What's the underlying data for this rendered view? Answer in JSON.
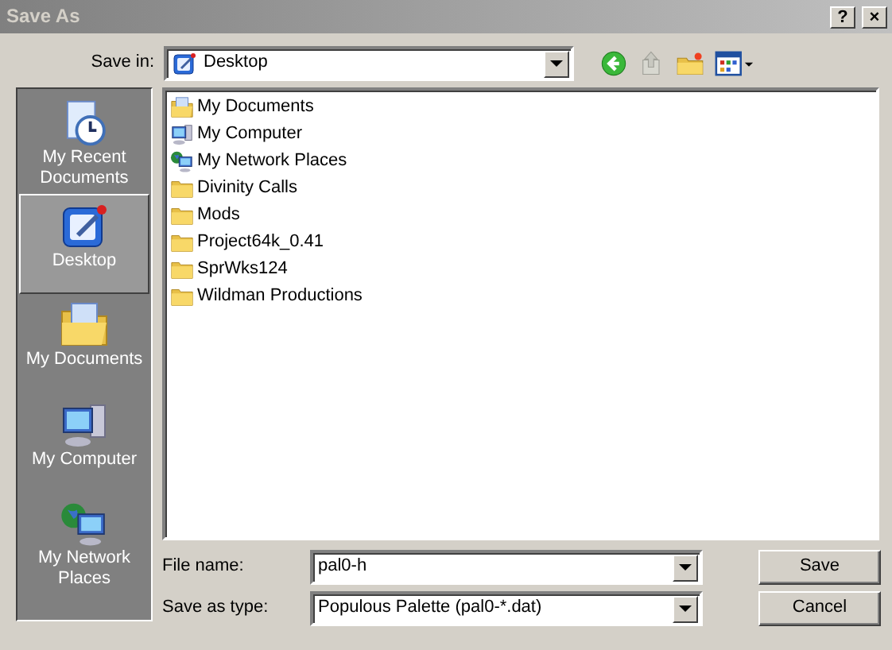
{
  "window": {
    "title": "Save As",
    "buttons": [
      "?",
      "×"
    ]
  },
  "save_in": {
    "label": "Save in:",
    "value": "Desktop",
    "kind": "desktop"
  },
  "toolbar": [
    {
      "kind": "back"
    },
    {
      "kind": "up"
    },
    {
      "kind": "new-folder"
    },
    {
      "kind": "views"
    }
  ],
  "places": [
    {
      "label": "My Recent Documents",
      "kind": "recent",
      "selected": false
    },
    {
      "label": "Desktop",
      "kind": "desktop",
      "selected": true
    },
    {
      "label": "My Documents",
      "kind": "documents",
      "selected": false
    },
    {
      "label": "My Computer",
      "kind": "computer",
      "selected": false
    },
    {
      "label": "My Network Places",
      "kind": "network",
      "selected": false
    }
  ],
  "files": [
    {
      "name": "My Documents",
      "kind": "documents"
    },
    {
      "name": "My Computer",
      "kind": "computer"
    },
    {
      "name": "My Network Places",
      "kind": "network"
    },
    {
      "name": "Divinity Calls",
      "kind": "folder"
    },
    {
      "name": "Mods",
      "kind": "folder"
    },
    {
      "name": "Project64k_0.41",
      "kind": "folder"
    },
    {
      "name": "SprWks124",
      "kind": "folder"
    },
    {
      "name": "Wildman Productions",
      "kind": "folder"
    }
  ],
  "file_name": {
    "label": "File name:",
    "value": "pal0-h"
  },
  "save_as_type": {
    "label": "Save as type:",
    "value": "Populous Palette (pal0-*.dat)"
  },
  "buttons": [
    "Save",
    "Cancel"
  ]
}
